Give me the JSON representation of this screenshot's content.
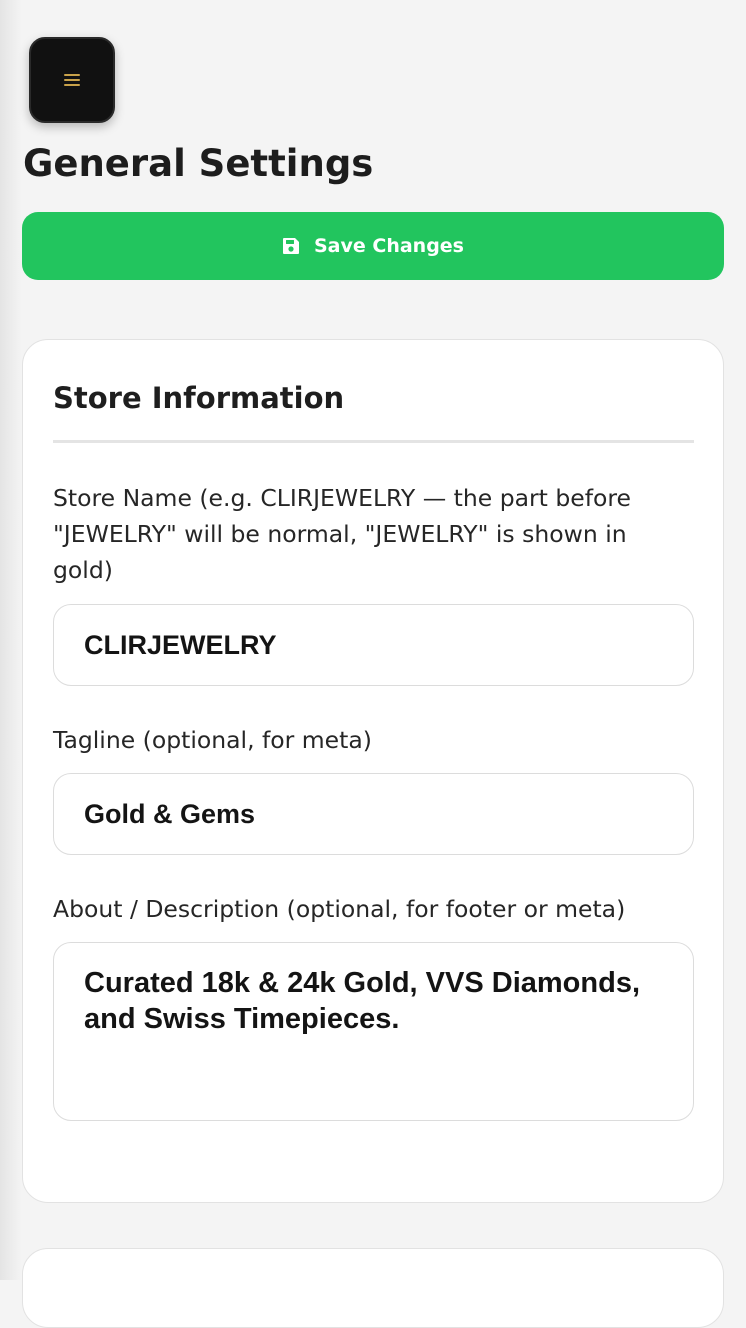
{
  "menu": {
    "icon": "hamburger-menu-icon",
    "accent_color": "#c9a24a"
  },
  "page": {
    "title": "General Settings"
  },
  "save_button": {
    "label": "Save Changes",
    "icon": "floppy-disk-icon",
    "color": "#22c55e"
  },
  "store_info": {
    "title": "Store Information",
    "store_name": {
      "label": "Store Name (e.g. CLIRJEWELRY — the part before \"JEWELRY\" will be normal, \"JEWELRY\" is shown in gold)",
      "value": "CLIRJEWELRY"
    },
    "tagline": {
      "label": "Tagline (optional, for meta)",
      "value": "Gold & Gems"
    },
    "about": {
      "label": "About / Description (optional, for footer or meta)",
      "value": "Curated 18k & 24k Gold, VVS Diamonds, and Swiss Timepieces."
    }
  }
}
